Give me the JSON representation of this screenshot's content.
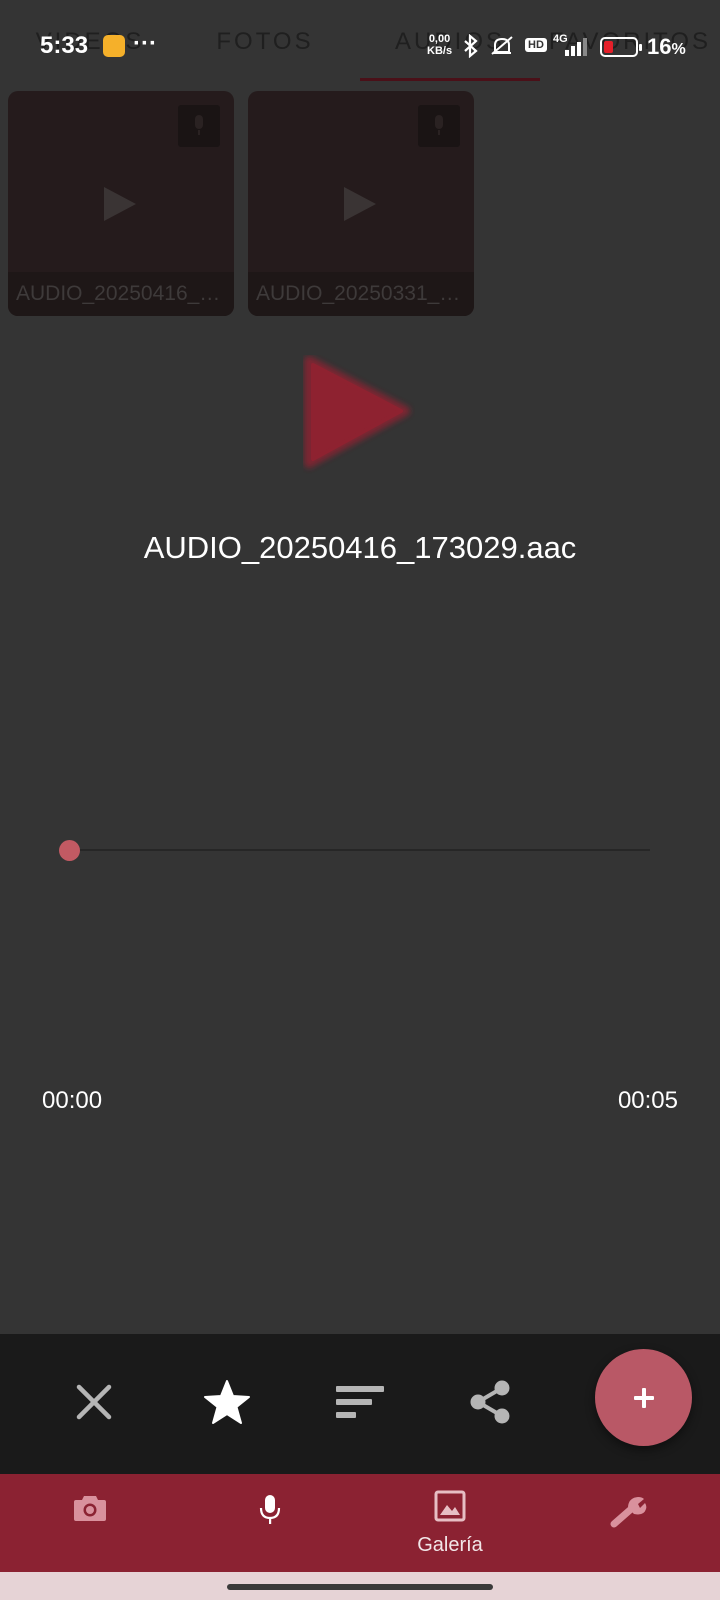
{
  "status_bar": {
    "time": "5:33",
    "dots": "···",
    "net_speed_value": "0,00",
    "net_speed_unit": "KB/s",
    "hd": "HD",
    "signal": "4G",
    "battery_percent": "16",
    "percent_sign": "%",
    "battery_color": "#e5202a"
  },
  "tabs": [
    {
      "label": "VIDEOS"
    },
    {
      "label": "FOTOS"
    },
    {
      "label": "AUDIOS"
    },
    {
      "label": "FAVORITOS"
    }
  ],
  "thumbnails": [
    {
      "caption": "AUDIO_20250416_…",
      "icon": "mic-icon"
    },
    {
      "caption": "AUDIO_20250331_…",
      "icon": "mic-icon"
    }
  ],
  "player": {
    "file_name": "AUDIO_20250416_173029.aac",
    "current_time": "00:00",
    "total_time": "00:05",
    "progress_fraction": 0
  },
  "actions": [
    {
      "icon": "close-icon"
    },
    {
      "icon": "star-icon"
    },
    {
      "icon": "sort-icon"
    },
    {
      "icon": "share-icon"
    }
  ],
  "fab_icon": "plus-icon",
  "bottom_nav": [
    {
      "icon": "camera-icon",
      "label": ""
    },
    {
      "icon": "mic-icon",
      "label": ""
    },
    {
      "icon": "gallery-icon",
      "label": "Galería"
    },
    {
      "icon": "wrench-icon",
      "label": ""
    }
  ],
  "colors": {
    "accent": "#8b2232",
    "fab": "#b95866",
    "seek_thumb": "#c25a63",
    "play_button": "#8e2230"
  }
}
